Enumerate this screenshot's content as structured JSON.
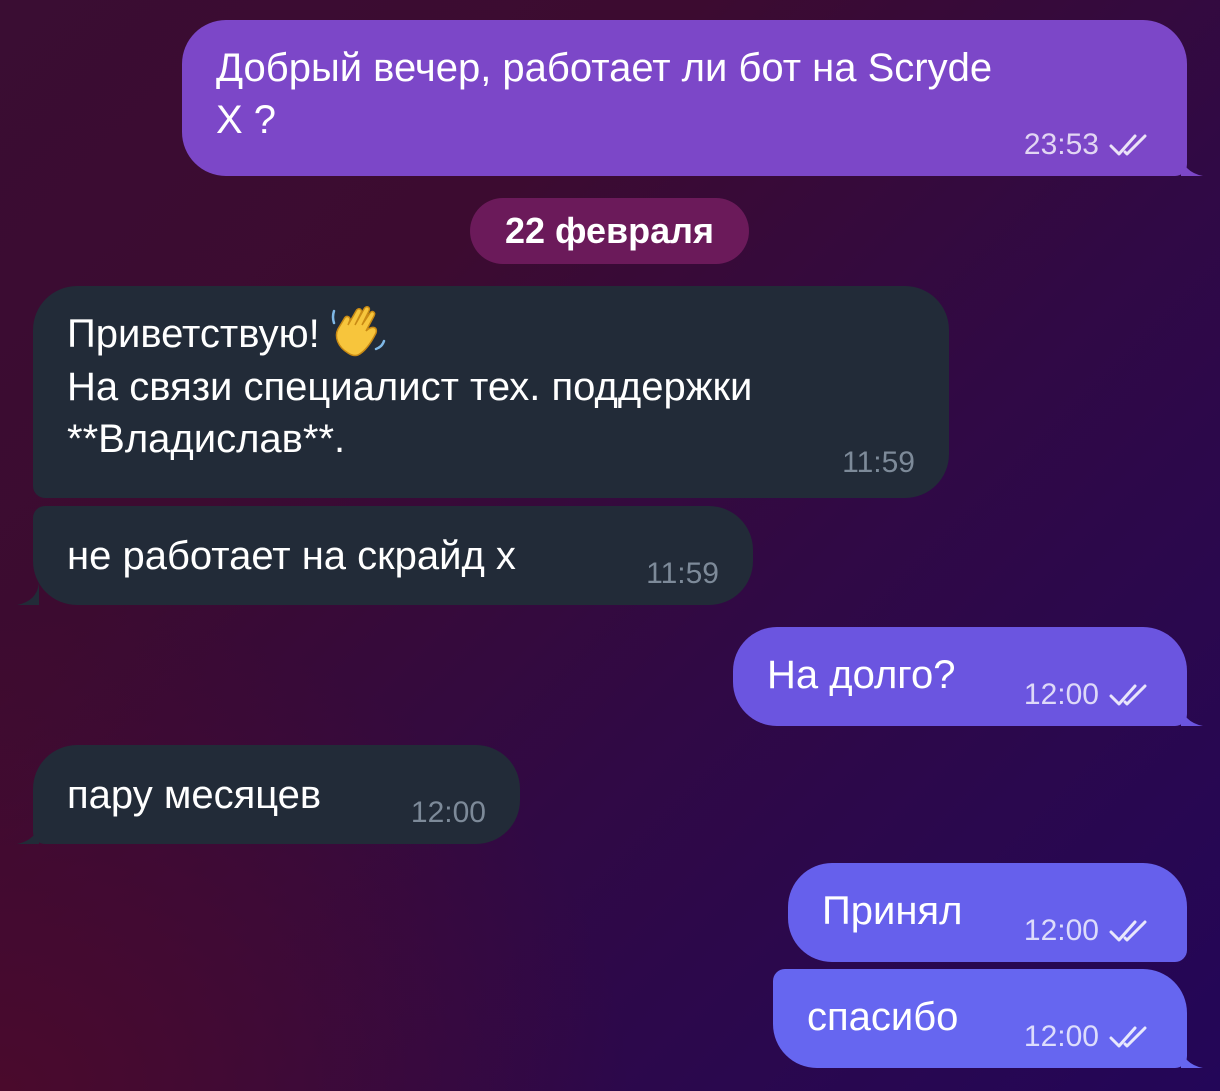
{
  "date_separator": "22 февраля",
  "messages": [
    {
      "direction": "out",
      "text": "Добрый вечер, работает ли бот на Scryde\nX ?",
      "time": "23:53",
      "status": "read",
      "color": "#7c47c8"
    },
    {
      "direction": "in",
      "text_line1": "Приветствую!",
      "emoji": "waving-hand",
      "text_rest": "На связи специалист тех. поддержки\n**Владислав**.",
      "time": "11:59",
      "color": "#222b38"
    },
    {
      "direction": "in",
      "text": "не работает на скрайд х",
      "time": "11:59",
      "color": "#222b38"
    },
    {
      "direction": "out",
      "text": "На долго?",
      "time": "12:00",
      "status": "read",
      "color": "#6b55e0"
    },
    {
      "direction": "in",
      "text": "пару месяцев",
      "time": "12:00",
      "color": "#222b38"
    },
    {
      "direction": "out",
      "text": "Принял",
      "time": "12:00",
      "status": "read",
      "color": "#6660ec"
    },
    {
      "direction": "out",
      "text": "спасибо",
      "time": "12:00",
      "status": "read",
      "color": "#6666f0"
    }
  ],
  "colors": {
    "incoming_bubble": "#222b38",
    "date_pill": "#6b1a5a",
    "background_top": "#3a0d33",
    "background_bottom_right": "#230658"
  }
}
